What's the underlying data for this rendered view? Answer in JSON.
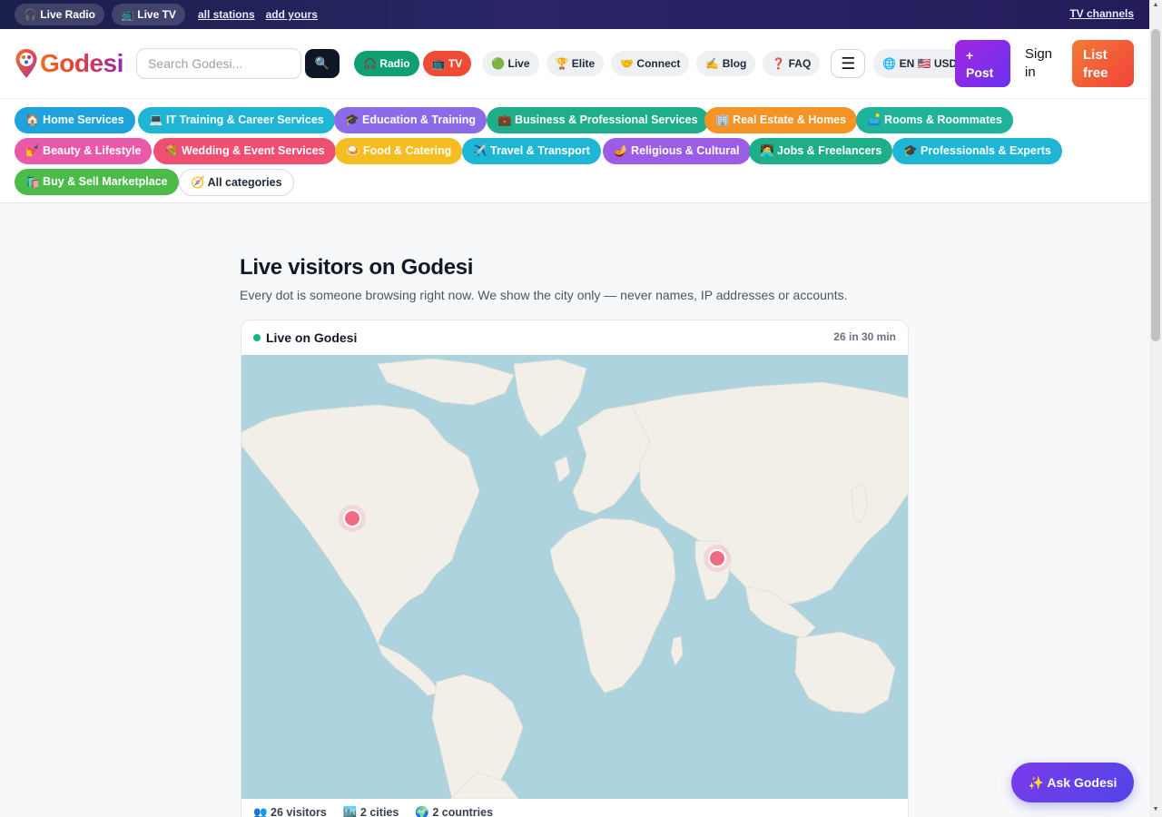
{
  "topbar": {
    "live_radio": "🎧 Live Radio",
    "live_tv": "📺 Live TV",
    "all_stations": "all stations",
    "add_yours": "add yours",
    "tv_channels": "TV channels"
  },
  "header": {
    "logo_text": "Godesi",
    "search_placeholder": "Search Godesi...",
    "search_icon": "🔍",
    "radio": "🎧 Radio",
    "tv": "📺 TV",
    "nav": [
      "🟢 Live",
      "🏆 Elite",
      "🤝 Connect",
      "✍️ Blog",
      "❓ FAQ"
    ],
    "menu_icon": "☰",
    "lang": "🌐 EN 🇺🇸 USD",
    "post": "+ Post",
    "signin": "Sign in",
    "listfree": "List free"
  },
  "categories": [
    {
      "label": "🏠 Home Services",
      "color": "#1fa3dc"
    },
    {
      "label": "💻 IT Training & Career Services",
      "color": "#1fb6d6"
    },
    {
      "label": "🎓 Education & Training",
      "color": "#8b6be8"
    },
    {
      "label": "💼 Business & Professional Services",
      "color": "#1fae8a"
    },
    {
      "label": "🏢 Real Estate & Homes",
      "color": "#f59324"
    },
    {
      "label": "🛋️ Rooms & Roommates",
      "color": "#1fb39b"
    },
    {
      "label": "💅 Beauty & Lifestyle",
      "color": "#e85aa9"
    },
    {
      "label": "💐 Wedding & Event Services",
      "color": "#ef4f70"
    },
    {
      "label": "🍛 Food & Catering",
      "color": "#f5bd22"
    },
    {
      "label": "✈️ Travel & Transport",
      "color": "#1fb6d6"
    },
    {
      "label": "🪔 Religious & Cultural",
      "color": "#9b5de5"
    },
    {
      "label": "🧑‍💻 Jobs & Freelancers",
      "color": "#1fae8a"
    },
    {
      "label": "🎓 Professionals & Experts",
      "color": "#1fb6d6"
    },
    {
      "label": "🛍️ Buy & Sell Marketplace",
      "color": "#4cbb4a"
    },
    {
      "label": "🧭 All categories",
      "color": "#ffffff"
    }
  ],
  "main": {
    "title": "Live visitors on Godesi",
    "subtitle": "Every dot is someone browsing right now. We show the city only — never names, IP addresses or accounts.",
    "card_title": "Live on Godesi",
    "card_count": "26 in 30 min",
    "map": {
      "ocean_color": "#add3df",
      "land_color": "#f2efe9",
      "marker_color": "#f06b86",
      "markers": [
        "us-west-marker",
        "india-marker"
      ]
    },
    "stats": {
      "visitors": "👥 26 visitors",
      "cities": "🏙️ 2 cities",
      "countries": "🌍 2 countries"
    }
  },
  "ask": {
    "label": "✨ Ask Godesi"
  }
}
